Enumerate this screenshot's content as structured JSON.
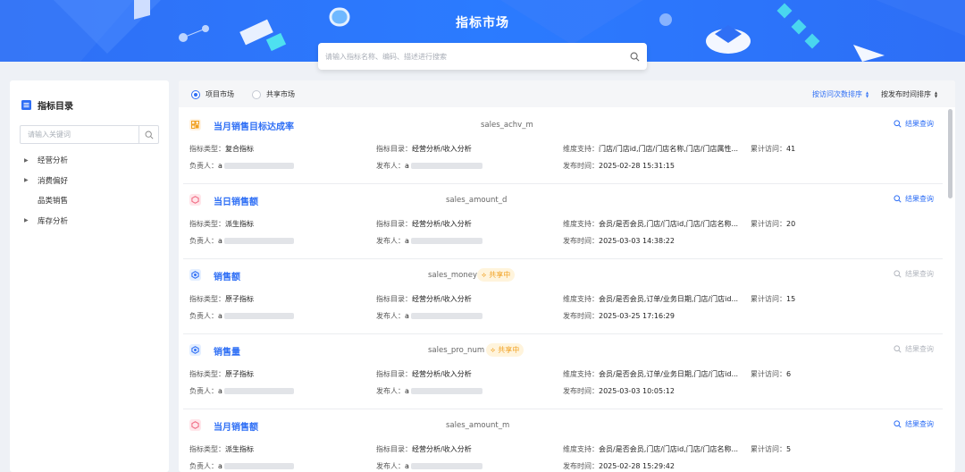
{
  "header": {
    "title": "指标市场",
    "search_placeholder": "请输入指标名称、编码、描述进行搜索"
  },
  "sidebar": {
    "title": "指标目录",
    "search_placeholder": "请输入关键词",
    "items": [
      {
        "label": "经营分析",
        "expandable": true
      },
      {
        "label": "消费偏好",
        "expandable": true
      },
      {
        "label": "品类销售",
        "expandable": false
      },
      {
        "label": "库存分析",
        "expandable": true
      }
    ]
  },
  "main": {
    "tabs": [
      {
        "label": "项目市场",
        "selected": true
      },
      {
        "label": "共享市场",
        "selected": false
      }
    ],
    "sort": {
      "by_visits": "按访问次数排序",
      "by_publish_time": "按发布时间排序"
    },
    "result_link_label": "结果查询",
    "field_labels": {
      "type": "指标类型：",
      "catalog": "指标目录：",
      "dimensions": "维度支持：",
      "visits": "累计访问：",
      "owner": "负责人：",
      "publisher": "发布人：",
      "publish_time": "发布时间："
    },
    "cards": [
      {
        "name": "当月销售目标达成率",
        "code": "sales_achv_m",
        "icon": "composite-icon",
        "type": "复合指标",
        "catalog": "经营分析/收入分析",
        "dimensions": "门店/门店id,门店/门店名称,门店/门店属性...",
        "visits": "41",
        "owner_prefix": "a",
        "publisher_prefix": "a",
        "publish_time": "2025-02-28 15:31:15",
        "shared_badge": "",
        "result_enabled": true
      },
      {
        "name": "当日销售额",
        "code": "sales_amount_d",
        "icon": "derived-icon",
        "type": "派生指标",
        "catalog": "经营分析/收入分析",
        "dimensions": "会员/是否会员,门店/门店id,门店/门店名称...",
        "visits": "20",
        "owner_prefix": "a",
        "publisher_prefix": "a",
        "publish_time": "2025-03-03 14:38:22",
        "shared_badge": "",
        "result_enabled": true
      },
      {
        "name": "销售额",
        "code": "sales_money",
        "icon": "atomic-icon",
        "type": "原子指标",
        "catalog": "经营分析/收入分析",
        "dimensions": "会员/是否会员,订单/业务日期,门店/门店id...",
        "visits": "15",
        "owner_prefix": "a",
        "publisher_prefix": "a",
        "publish_time": "2025-03-25 17:16:29",
        "shared_badge": "共享中",
        "result_enabled": false
      },
      {
        "name": "销售量",
        "code": "sales_pro_num",
        "icon": "atomic-icon",
        "type": "原子指标",
        "catalog": "经营分析/收入分析",
        "dimensions": "会员/是否会员,订单/业务日期,门店/门店id...",
        "visits": "6",
        "owner_prefix": "a",
        "publisher_prefix": "a",
        "publish_time": "2025-03-03 10:05:12",
        "shared_badge": "共享中",
        "result_enabled": false
      },
      {
        "name": "当月销售额",
        "code": "sales_amount_m",
        "icon": "derived-icon",
        "type": "派生指标",
        "catalog": "经营分析/收入分析",
        "dimensions": "会员/是否会员,门店/门店id,门店/门店名称...",
        "visits": "5",
        "owner_prefix": "a",
        "publisher_prefix": "a",
        "publish_time": "2025-02-28 15:29:42",
        "shared_badge": "",
        "result_enabled": true
      }
    ]
  },
  "colors": {
    "primary": "#2f6ff5",
    "badge_text": "#f0a020",
    "badge_bg": "#fff4dc",
    "disabled": "#b3b7bf"
  }
}
